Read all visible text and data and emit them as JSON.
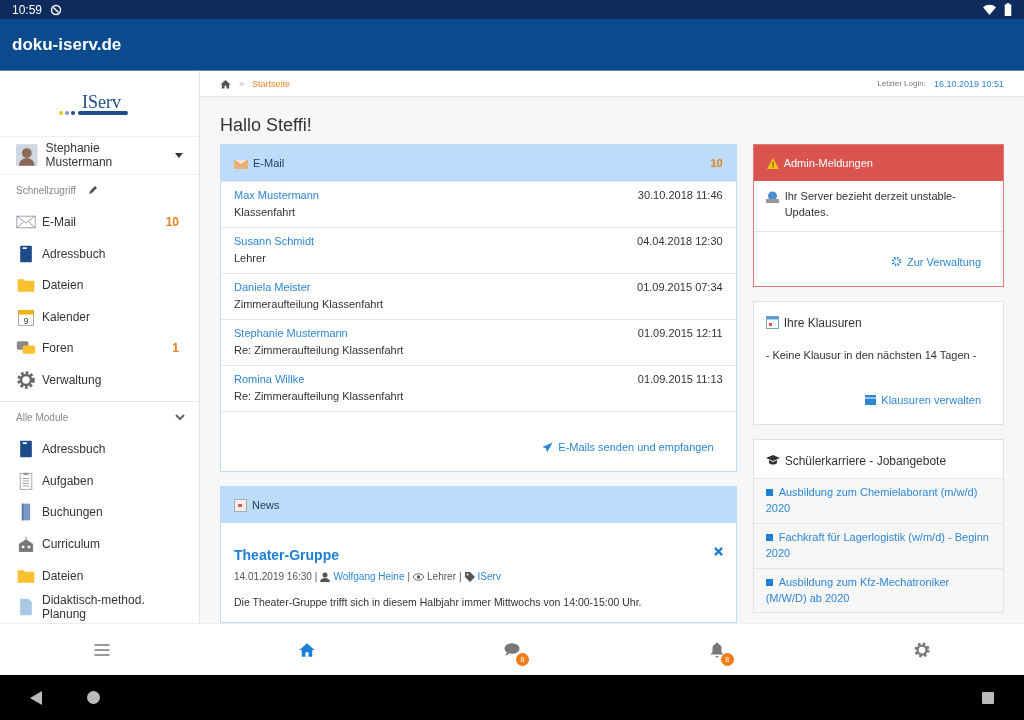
{
  "status_bar": {
    "time": "10:59"
  },
  "app_bar": {
    "title": "doku-iserv.de"
  },
  "sidebar": {
    "logo": "IServ",
    "user": "Stephanie Mustermann",
    "quick_access": {
      "title": "Schnellzugriff",
      "items": [
        {
          "label": "E-Mail",
          "kind": "mail",
          "count": "10"
        },
        {
          "label": "Adressbuch",
          "kind": "book"
        },
        {
          "label": "Dateien",
          "kind": "folder"
        },
        {
          "label": "Kalender",
          "kind": "calendar",
          "icon_text": "9"
        },
        {
          "label": "Foren",
          "kind": "forum",
          "count": "1"
        },
        {
          "label": "Verwaltung",
          "kind": "gear"
        }
      ]
    },
    "modules": {
      "title": "Alle Module",
      "expanded": true,
      "items": [
        {
          "label": "Adressbuch",
          "kind": "book"
        },
        {
          "label": "Aufgaben",
          "kind": "tasks"
        },
        {
          "label": "Buchungen",
          "kind": "booking"
        },
        {
          "label": "Curriculum",
          "kind": "school"
        },
        {
          "label": "Dateien",
          "kind": "folder"
        },
        {
          "label": "Didaktisch-method. Planung",
          "kind": "document"
        }
      ]
    }
  },
  "breadcrumb": {
    "separator": "»",
    "current": "Startseite",
    "last_login_label": "Letzter Login:",
    "last_login": "16.10.2019 10:51"
  },
  "greeting": "Hallo Steffi!",
  "email_card": {
    "title": "E-Mail",
    "count": "10",
    "messages": [
      {
        "sender": "Max Mustermann",
        "subject": "Klassenfahrt",
        "date": "30.10.2018 11:46"
      },
      {
        "sender": "Susann Schmidt",
        "subject": "Lehrer",
        "date": "04.04.2018 12:30"
      },
      {
        "sender": "Daniela Meister",
        "subject": "Zimmeraufteilung Klassenfahrt",
        "date": "01.09.2015 07:34"
      },
      {
        "sender": "Stephanie Mustermann",
        "subject": "Re: Zimmeraufteilung Klassenfahrt",
        "date": "01.09.2015 12:11"
      },
      {
        "sender": "Romina Willke",
        "subject": "Re: Zimmeraufteilung Klassenfahrt",
        "date": "01.09.2015 11:13"
      }
    ],
    "link": "E-Mails senden und empfangen"
  },
  "news_card": {
    "title": "News",
    "item": {
      "headline": "Theater-Gruppe",
      "date": "14.01.2019 16:30",
      "author": "Wolfgang Heine",
      "audience": "Lehrer",
      "tag": "IServ",
      "separators": [
        "|",
        "|",
        "|"
      ],
      "text": "Die Theater-Gruppe trifft sich in diesem Halbjahr immer Mittwochs von 14:00-15:00 Uhr."
    }
  },
  "admin_card": {
    "title": "Admin-Meldungen",
    "message": "Ihr Server bezieht derzeit unstable-Updates.",
    "link": "Zur Verwaltung"
  },
  "exams_card": {
    "title": "Ihre Klausuren",
    "message": "- Keine Klausur in den nächsten 14 Tagen -",
    "link": "Klausuren verwalten"
  },
  "jobs_card": {
    "title": "Schülerkarriere - Jobangebote",
    "jobs": [
      "Ausbildung zum Chemielaborant (m/w/d) 2020",
      "Fachkraft für Lagerlogistik (w/m/d) - Beginn 2020",
      "Ausbildung zum Kfz-Mechatroniker (M/W/D) ab 2020"
    ]
  },
  "bottom_nav": [
    {
      "kind": "menu",
      "selected": false
    },
    {
      "kind": "home",
      "selected": true
    },
    {
      "kind": "chat",
      "selected": false,
      "badge": "8"
    },
    {
      "kind": "bell",
      "selected": false,
      "badge": "8"
    },
    {
      "kind": "settings",
      "selected": false
    }
  ]
}
